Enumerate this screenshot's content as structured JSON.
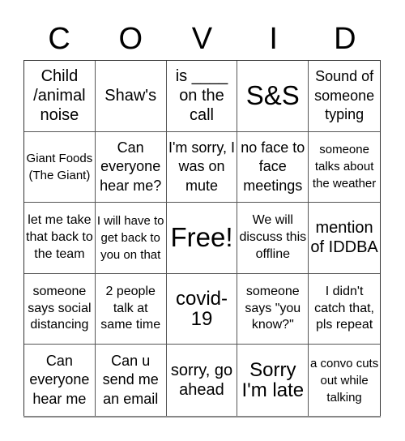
{
  "title_letters": [
    "C",
    "O",
    "V",
    "I",
    "D"
  ],
  "cells": [
    {
      "text": "Child /animal noise",
      "size": "m"
    },
    {
      "text": "Shaw's",
      "size": "m"
    },
    {
      "text": "is ____ on the call",
      "size": "m"
    },
    {
      "text": "S&S",
      "size": "xl"
    },
    {
      "text": "Sound of someone typing",
      "size": "ms"
    },
    {
      "text": "Giant Foods (The Giant)",
      "size": "xs"
    },
    {
      "text": "Can everyone hear me?",
      "size": "ms"
    },
    {
      "text": "I'm sorry, I was on mute",
      "size": "ms"
    },
    {
      "text": "no face to face meetings",
      "size": "ms"
    },
    {
      "text": "someone talks about the weather",
      "size": "xs"
    },
    {
      "text": "let me take that back to the team",
      "size": "s"
    },
    {
      "text": "I will have to get back to you on that",
      "size": "xs"
    },
    {
      "text": "Free!",
      "size": "xl"
    },
    {
      "text": "We will discuss this offline",
      "size": "s"
    },
    {
      "text": "mention of IDDBA",
      "size": "m"
    },
    {
      "text": "someone says social distancing",
      "size": "s"
    },
    {
      "text": "2 people talk at same time",
      "size": "s"
    },
    {
      "text": "covid-19",
      "size": "l"
    },
    {
      "text": "someone says \"you know?\"",
      "size": "s"
    },
    {
      "text": "I didn't catch that, pls repeat",
      "size": "s"
    },
    {
      "text": "Can everyone hear me",
      "size": "ms"
    },
    {
      "text": "Can u send me an email",
      "size": "ms"
    },
    {
      "text": "sorry, go ahead",
      "size": "m"
    },
    {
      "text": "Sorry I'm late",
      "size": "l"
    },
    {
      "text": "a convo cuts out while talking",
      "size": "xs"
    }
  ]
}
